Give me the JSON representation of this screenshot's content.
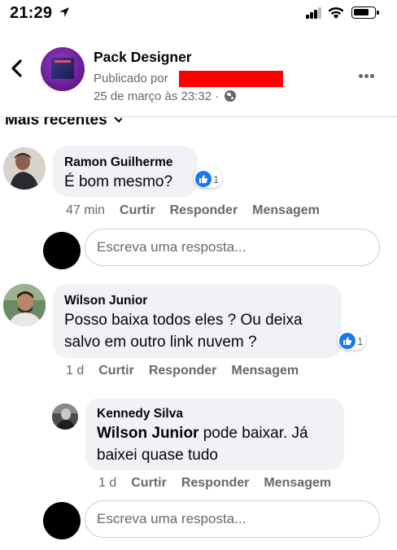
{
  "status_bar": {
    "time": "21:29"
  },
  "post": {
    "page_name": "Pack Designer",
    "published_prefix": "Publicado por",
    "date": "25 de março às 23:32 ·",
    "sort_label": "Mais recentes"
  },
  "comments": [
    {
      "author": "Ramon Guilherme",
      "text": "É bom mesmo?",
      "reactions": "1",
      "time": "47 min",
      "like": "Curtir",
      "reply": "Responder",
      "message": "Mensagem"
    },
    {
      "author": "Wilson Junior",
      "text_line1": "Posso baixa todos eles ? Ou deixa",
      "text_line2": "salvo em outro link nuvem ?",
      "reactions": "1",
      "time": "1 d",
      "like": "Curtir",
      "reply": "Responder",
      "message": "Mensagem",
      "replies": [
        {
          "author": "Kennedy Silva",
          "mention": "Wilson Junior",
          "text_line1_rest": " pode baixar. Já",
          "text_line2": "baixei quase tudo",
          "time": "1 d",
          "like": "Curtir",
          "reply": "Responder",
          "message": "Mensagem"
        }
      ]
    }
  ],
  "reply_input": {
    "placeholder": "Escreva uma resposta..."
  },
  "colors": {
    "like_blue": "#1877f2",
    "bubble_bg": "#f0f2f5",
    "redaction": "#ff0000"
  },
  "icons": [
    "location-arrow-icon",
    "signal-icon",
    "wifi-icon",
    "battery-icon",
    "back-chevron-icon",
    "globe-icon",
    "more-dots-icon",
    "chevron-down-icon",
    "like-icon"
  ]
}
